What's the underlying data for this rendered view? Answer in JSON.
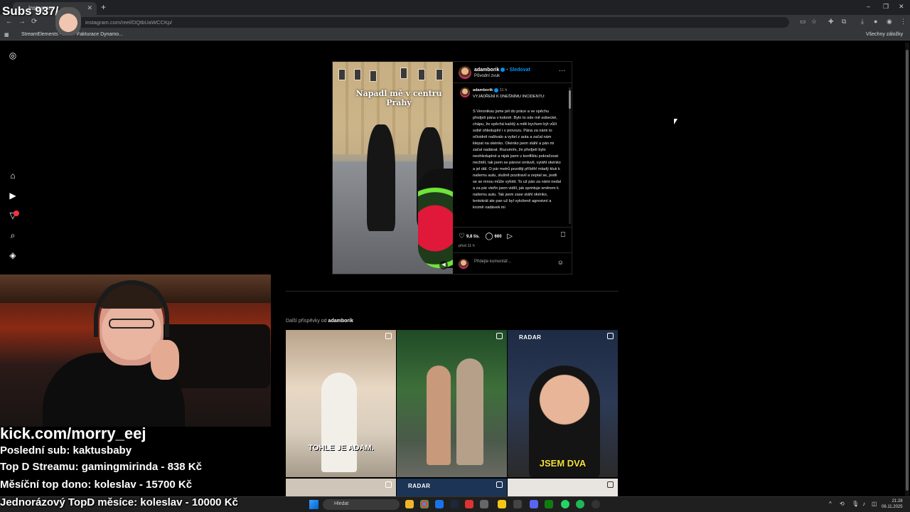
{
  "browser": {
    "tab_title": "Instagram",
    "url": "instagram.com/reel/DQtbUaWCCKp/",
    "bookmarks": [
      "StreamElements - ...",
      "Fakturace Dynamo..."
    ],
    "all_bookmarks": "Všechny záložky"
  },
  "post": {
    "username": "adamborik",
    "follow": "Sledovat",
    "audio": "Původní zvuk",
    "overlay_text": "Napadl mě v centru Prahy",
    "caption_time": "11 h",
    "caption_title": "VYJÁDŘENÍ K DNEŠNÍMU INCIDENTU:",
    "caption_body": "S Veronikou jsme jeli do práce a ve spěchu předjeli pána v koloně. Bylo to ode mě sobecké, chápu, že spěchá každý a měli bychom být vůči sobě ohleduplní i v provozu. Pána za námi to očividně naštvalo a vyšel z auta a začal nám klepat na okénko. Okénko jsem stáhl a pán mi začal nadávat. Rozumím, že předjetí bylo neohleduplné a nijak jsem v konfliktu pokračovat nechtěl, tak jsem se pánovi omluvil, vytáhl okénko a jel dál. O pár metrů později příběh! mladý kluk k našemu autu, slušně pozdravil a zeptal se, jestli se se mnou může vyfotit. To už pán za námi nedal a za pár vteřin jsem viděl, jak sprintuje směrem k našemu autu. Tak jsem zase stáhl okénko, tentokrát ale pan už byl vyloženě agresivní a kromě nadávek mi",
    "likes": "9,8 tis.",
    "comments": "660",
    "posted": "před 11 h",
    "comment_placeholder": "Přidejte komentář..."
  },
  "more_posts": {
    "label": "Další příspěvky od",
    "user": "adamborik",
    "items": [
      {
        "caption": "TOHLE JE ADAM."
      },
      {
        "caption": ""
      },
      {
        "brand": "RADAR",
        "caption": "JSEM DVA"
      },
      {
        "caption": ""
      },
      {
        "brand": "RADAR",
        "caption": ""
      },
      {
        "caption": ""
      }
    ]
  },
  "stream_overlay": {
    "subs": "Subs 937/",
    "kick": "kick.com/morry_eej",
    "last_sub": "Poslední sub: kaktusbaby",
    "top_donor": "Top D Streamu: gamingmirinda - 838 Kč",
    "monthly_top": "Měsíční top dono: koleslav - 15700 Kč",
    "one_time_top": "Jednorázový TopD měsíce: koleslav - 10000 Kč"
  },
  "taskbar": {
    "search": "Hledat",
    "time": "21:28",
    "date": "06.11.2025"
  },
  "colors": {
    "accent": "#0095f6",
    "background": "#000000",
    "border": "#262626"
  }
}
